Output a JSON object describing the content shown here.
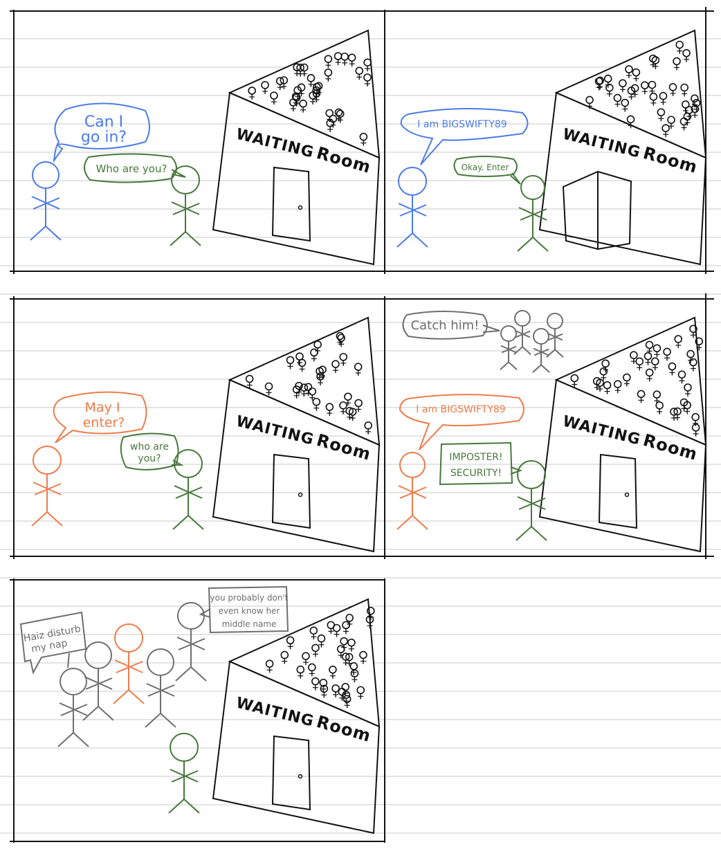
{
  "colors": {
    "blue": "#4a7be8",
    "green": "#46783a",
    "orange": "#ee7b4a",
    "gray": "#6e6e6e",
    "ink": "#111111",
    "ruled_line": "#c9c9c9"
  },
  "building": {
    "sign_word_1": "WAITING",
    "sign_word_2": "Room"
  },
  "panels": {
    "p1": {
      "blue_speech": [
        "Can I",
        "go in?"
      ],
      "green_speech": "Who are you?"
    },
    "p2": {
      "blue_speech": "I am BIGSWIFTY89",
      "green_speech": "Okay. Enter"
    },
    "p3": {
      "orange_speech": [
        "May I",
        "enter?"
      ],
      "green_speech": [
        "who are",
        "you?"
      ]
    },
    "p4": {
      "gray_speech": "Catch him!",
      "orange_speech": "I am BIGSWIFTY89",
      "green_speech": [
        "IMPOSTER!",
        "SECURITY!"
      ]
    },
    "p5": {
      "left_speech": [
        "Haiz disturb",
        "my nap"
      ],
      "right_speech": [
        "you probably don't",
        "even know her",
        "middle name"
      ]
    }
  }
}
